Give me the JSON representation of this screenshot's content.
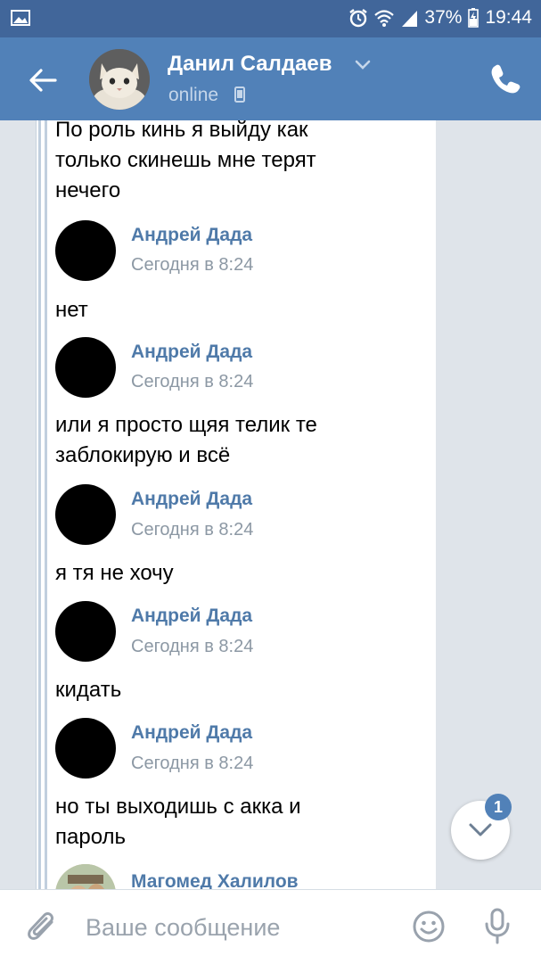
{
  "status_bar": {
    "battery": "37%",
    "time": "19:44"
  },
  "header": {
    "name": "Данил Салдаев",
    "status": "online"
  },
  "messages": {
    "top_text": "По роль кинь я выйду как\nтолько скинешь мне терят\nнечего",
    "items": [
      {
        "author": "Андрей Дада",
        "time": "Сегодня в 8:24",
        "text": "нет"
      },
      {
        "author": "Андрей Дада",
        "time": "Сегодня в 8:24",
        "text": "или я просто щяя телик те\nзаблокирую и всё"
      },
      {
        "author": "Андрей Дада",
        "time": "Сегодня в 8:24",
        "text": "я тя не хочу"
      },
      {
        "author": "Андрей Дада",
        "time": "Сегодня в 8:24",
        "text": "кидать"
      },
      {
        "author": "Андрей Дада",
        "time": "Сегодня в 8:24",
        "text": "но ты выходишь с акка и\nпароль"
      }
    ],
    "last_author": "Магомед Халилов"
  },
  "scroll_badge": "1",
  "input": {
    "placeholder": "Ваше сообщение",
    "value": ""
  },
  "colors": {
    "header": "#5181b8",
    "status_bar": "#41669a",
    "author_name": "#4f7aa9"
  },
  "icons": [
    "image-icon",
    "alarm-icon",
    "wifi-icon",
    "signal-icon",
    "battery-icon",
    "back-arrow-icon",
    "chevron-down-icon",
    "mobile-icon",
    "phone-icon",
    "paperclip-icon",
    "emoji-icon",
    "mic-icon"
  ]
}
